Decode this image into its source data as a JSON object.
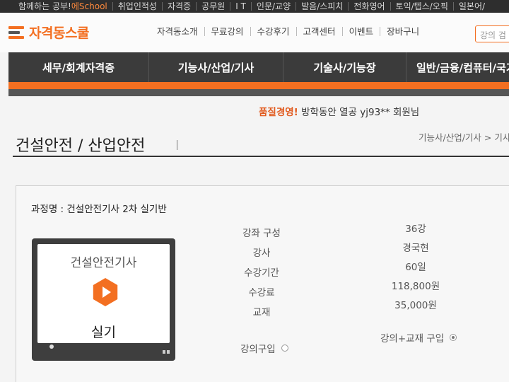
{
  "topbar": {
    "items": [
      "함께하는 공부!",
      "취업인적성",
      "자격증",
      "공무원",
      "I T",
      "인문/교양",
      "발음/스피치",
      "전화영어",
      "토익/텝스/오픽",
      "일본어/"
    ],
    "brand": "에School"
  },
  "header": {
    "logo_text": "자격동스쿨",
    "nav": [
      "자격동소개",
      "무료강의",
      "수강후기",
      "고객센터",
      "이벤트",
      "장바구니"
    ],
    "search_placeholder": "강의 검"
  },
  "categories": [
    "세무/회계자격증",
    "기능사/산업/기사",
    "기술사/기능장",
    "일반/금융/컴퓨터/국가"
  ],
  "welcome": {
    "tag": "품질경영!",
    "text": "방학동안 열공 yj93** 회원님"
  },
  "page": {
    "title": "건설안전 / 산업안전",
    "breadcrumb": "기능사/산업/기사 > 기사"
  },
  "course": {
    "name": "과정명 : 건설안전기사 2차 실기반",
    "thumb_title": "건설안전기사",
    "thumb_sub": "실기",
    "info": [
      {
        "label": "강좌 구성",
        "value": "36강"
      },
      {
        "label": "강사",
        "value": "경국현"
      },
      {
        "label": "수강기간",
        "value": "60일"
      },
      {
        "label": "수강료",
        "value": "118,800원"
      },
      {
        "label": "교재",
        "value": "35,000원"
      }
    ],
    "buy_lecture_label": "강의구입",
    "buy_lecture_selected": false,
    "buy_bundle_label": "강의+교재 구입",
    "buy_bundle_selected": true
  },
  "colors": {
    "accent": "#f36f21",
    "dark": "#3b3b3b"
  }
}
